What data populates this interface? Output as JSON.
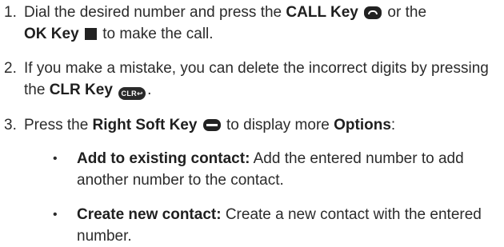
{
  "steps": [
    {
      "number": "1.",
      "line1_pre": "Dial the desired number and press the ",
      "call_key": "CALL Key",
      "line1_mid": " or the",
      "ok_key": "OK Key",
      "line1_post": " to make the call."
    },
    {
      "number": "2.",
      "text_pre": "If you make a mistake, you can delete the incorrect digits by pressing the ",
      "clr_key": "CLR Key",
      "clr_icon_label": "CLR↩",
      "text_post": "."
    },
    {
      "number": "3.",
      "text_pre": "Press the ",
      "soft_key": "Right Soft Key",
      "text_mid": " to display more ",
      "options": "Options",
      "text_post": ":"
    }
  ],
  "bullets": [
    {
      "marker": "•",
      "term": "Add to existing contact:",
      "desc": " Add the entered number to add another number to the contact."
    },
    {
      "marker": "•",
      "term": "Create new contact:",
      "desc": " Create a new contact with the entered number."
    }
  ],
  "icons": {
    "call": "call-key-icon",
    "ok": "ok-key-icon",
    "clr": "clr-key-icon",
    "soft": "right-soft-key-icon"
  }
}
